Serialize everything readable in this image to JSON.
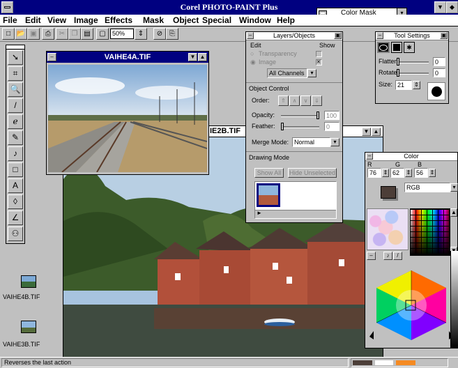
{
  "app": {
    "title": "Corel PHOTO-PAINT Plus",
    "menu": [
      "File",
      "Edit",
      "View",
      "Image",
      "Effects",
      "Mask",
      "Object",
      "Special",
      "Window",
      "Help"
    ],
    "mask_mode": "Color Mask",
    "zoom": "50%",
    "status_text": "Reverses the last action"
  },
  "docs": {
    "front_title": "VAIHE4A.TIF",
    "back_title": "VAIHE2B.TIF",
    "back_title_visible": "IE2B.TIF"
  },
  "thumbnails": [
    {
      "label": "VAIHE4B.TIF"
    },
    {
      "label": "VAIHE3B.TIF"
    }
  ],
  "layers_panel": {
    "title": "Layers/Objects",
    "edit_label": "Edit",
    "show_label": "Show",
    "transparency_label": "Transparency",
    "image_label": "Image",
    "channels_value": "All Channels",
    "object_control_label": "Object Control",
    "order_label": "Order:",
    "opacity_label": "Opacity:",
    "opacity_value": "100",
    "feather_label": "Feather:",
    "feather_value": "0",
    "merge_mode_label": "Merge Mode:",
    "merge_mode_value": "Normal",
    "drawing_mode_label": "Drawing Mode",
    "show_all_label": "Show All",
    "hide_unselected_label": "Hide Unselected"
  },
  "tool_settings": {
    "title": "Tool Settings",
    "flatten_label": "Flatten:",
    "flatten_value": "0",
    "rotate_label": "Rotate:",
    "rotate_value": "0",
    "size_label": "Size:",
    "size_value": "21"
  },
  "color_panel": {
    "title": "Color",
    "r_label": "R",
    "g_label": "G",
    "b_label": "B",
    "r_value": "76",
    "g_value": "62",
    "b_value": "56",
    "model_value": "RGB"
  },
  "icons": {
    "control_menu": "dash-box",
    "minimize": "down-triangle",
    "maximize": "up-triangle"
  }
}
